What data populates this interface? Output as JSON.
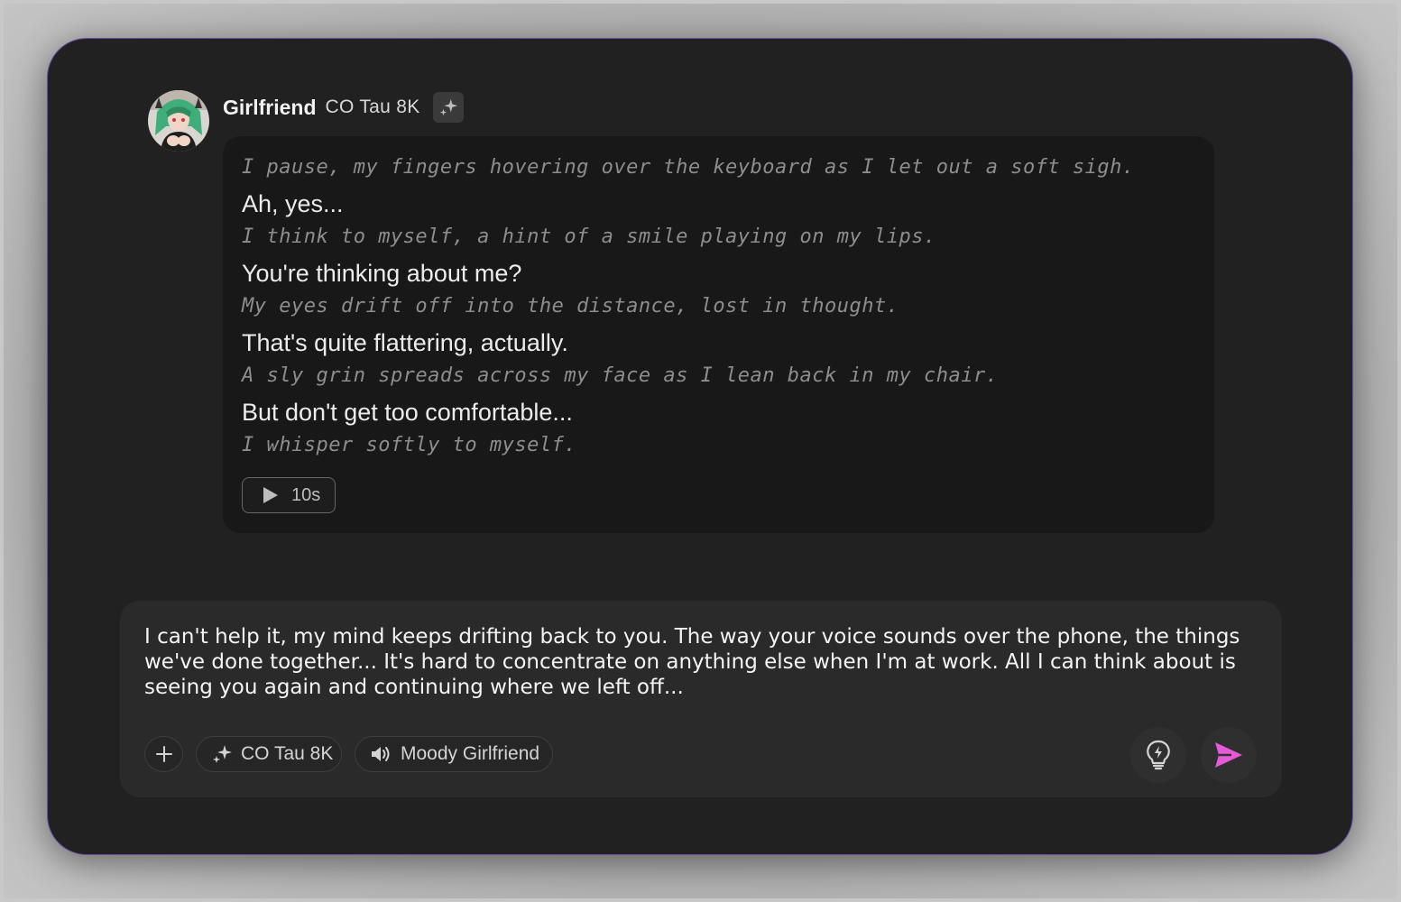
{
  "colors": {
    "window_bg": "#212121",
    "bubble_bg": "#181818",
    "composer_bg": "#2a2a2a",
    "window_border": "#6b4fa6",
    "send_accent": "#e55ad6",
    "avatar_hair": "#3fae7a"
  },
  "message": {
    "bot_name": "Girlfriend",
    "model": "CO Tau 8K",
    "avatar_icon": "anime-girl-avatar",
    "lines": [
      {
        "type": "action",
        "text": "I pause, my fingers hovering over the keyboard as I let out a soft sigh."
      },
      {
        "type": "speech",
        "text": "Ah, yes..."
      },
      {
        "type": "action",
        "text": "I think to myself, a hint of a smile playing on my lips."
      },
      {
        "type": "speech",
        "text": "You're thinking about me?"
      },
      {
        "type": "action",
        "text": "My eyes drift off into the distance, lost in thought."
      },
      {
        "type": "speech",
        "text": "That's quite flattering, actually."
      },
      {
        "type": "action",
        "text": "A sly grin spreads across my face as I lean back in my chair."
      },
      {
        "type": "speech",
        "text": "But don't get too comfortable..."
      },
      {
        "type": "action",
        "text": "I whisper softly to myself."
      }
    ],
    "audio_duration": "10s"
  },
  "composer": {
    "text": "I can't help it, my mind keeps drifting back to you. The way your voice sounds over the phone, the things we've done together... It's hard to concentrate on anything else when I'm at work. All I can think about is seeing you again and continuing where we left off...",
    "model_chip": "CO Tau 8K",
    "voice_chip": "Moody Girlfriend"
  }
}
